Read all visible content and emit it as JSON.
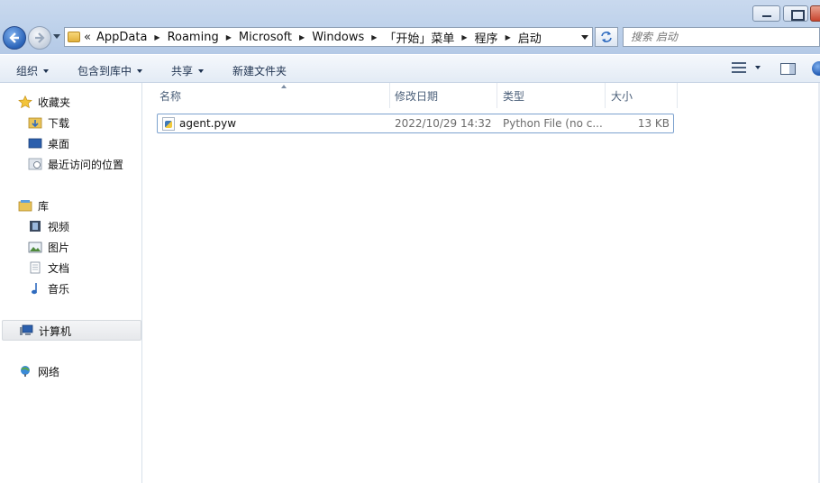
{
  "window": {
    "controls": {
      "minimize": "",
      "maximize": "",
      "close": ""
    }
  },
  "address": {
    "overflow": "«",
    "breadcrumbs": [
      "AppData",
      "Roaming",
      "Microsoft",
      "Windows",
      "「开始」菜单",
      "程序",
      "启动"
    ]
  },
  "search": {
    "placeholder": "搜索 启动"
  },
  "commandbar": {
    "organize": "组织",
    "include_in_library": "包含到库中",
    "share": "共享",
    "new_folder": "新建文件夹"
  },
  "navpane": {
    "favorites": {
      "label": "收藏夹",
      "items": [
        "下载",
        "桌面",
        "最近访问的位置"
      ]
    },
    "libraries": {
      "label": "库",
      "items": [
        "视频",
        "图片",
        "文档",
        "音乐"
      ]
    },
    "computer": "计算机",
    "network": "网络"
  },
  "filelist": {
    "columns": {
      "name": "名称",
      "date": "修改日期",
      "type": "类型",
      "size": "大小"
    },
    "files": [
      {
        "name": "agent.pyw",
        "date": "2022/10/29 14:32",
        "type": "Python File (no c...",
        "size": "13 KB"
      }
    ]
  },
  "colors": {
    "selection_border": "#7da2ce",
    "header_text": "#4c607a",
    "command_text": "#1e3250"
  }
}
